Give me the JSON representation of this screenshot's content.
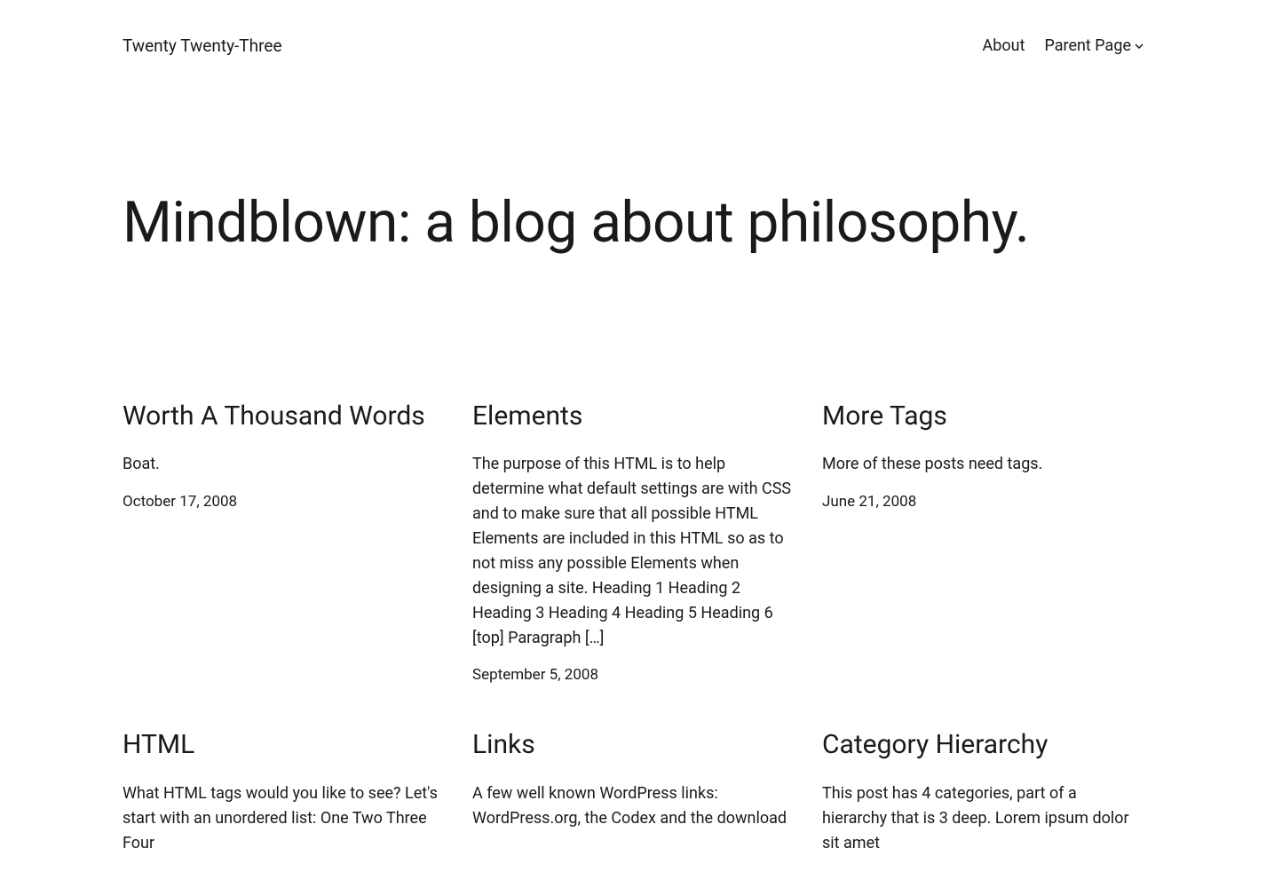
{
  "header": {
    "site_title": "Twenty Twenty-Three",
    "nav": {
      "about": "About",
      "parent_page": "Parent Page"
    }
  },
  "hero": {
    "heading": "Mindblown: a blog about philosophy."
  },
  "posts": [
    {
      "title": "Worth A Thousand Words",
      "excerpt": "Boat.",
      "date": "October 17, 2008"
    },
    {
      "title": "Elements",
      "excerpt": "The purpose of this HTML is to help determine what default settings are with CSS and to make sure that all possible HTML Elements are included in this HTML so as to not miss any possible Elements when designing a site. Heading 1 Heading 2 Heading 3 Heading 4 Heading 5 Heading 6 [top] Paragraph […]",
      "date": "September 5, 2008"
    },
    {
      "title": "More Tags",
      "excerpt": "More of these posts need tags.",
      "date": "June 21, 2008"
    },
    {
      "title": "HTML",
      "excerpt": "What HTML tags would you like to see? Let's start with an unordered list: One Two Three Four",
      "date": ""
    },
    {
      "title": "Links",
      "excerpt": "A few well known WordPress links: WordPress.org, the Codex and the download",
      "date": ""
    },
    {
      "title": "Category Hierarchy",
      "excerpt": "This post has 4 categories, part of a hierarchy that is 3 deep. Lorem ipsum dolor sit amet",
      "date": ""
    }
  ]
}
